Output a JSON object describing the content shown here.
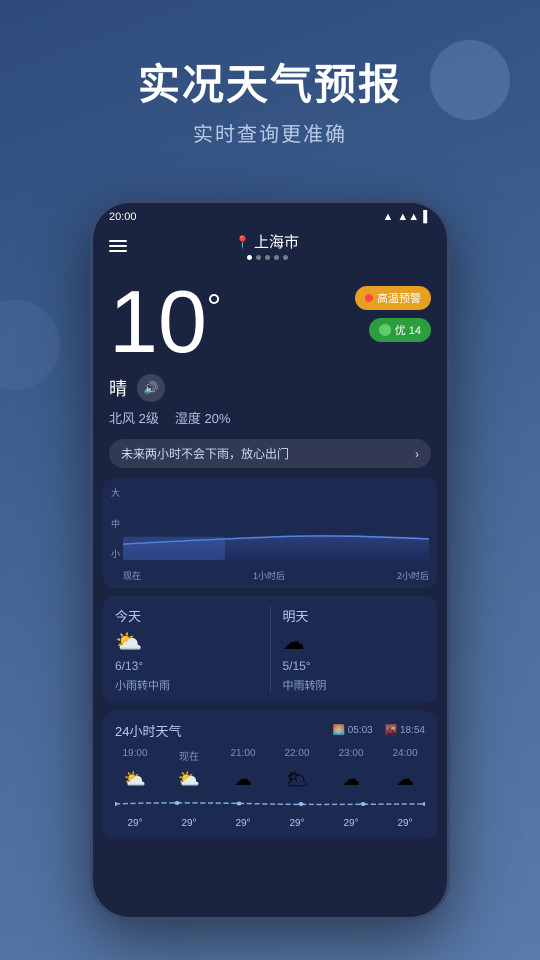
{
  "app": {
    "title": "实况天气预报",
    "subtitle": "实时查询更准确"
  },
  "status_bar": {
    "time": "20:00",
    "wifi": "▲",
    "signal": "▲▲",
    "battery": "▌"
  },
  "nav": {
    "city": "上海市",
    "dots": [
      true,
      false,
      false,
      false,
      false
    ]
  },
  "weather": {
    "temperature": "10",
    "degree_symbol": "°",
    "condition": "晴",
    "alert_label": "高温预警",
    "aqi_label": "优 14",
    "wind": "北风 2级",
    "humidity": "湿度 20%",
    "forecast_hint": "未来两小时不会下雨，放心出门"
  },
  "precip_chart": {
    "y_labels": [
      "大",
      "中",
      "小"
    ],
    "x_labels": [
      "现在",
      "1小时后",
      "2小时后"
    ]
  },
  "daily": {
    "today": {
      "label": "今天",
      "temp": "6/13°",
      "condition": "小雨转中雨"
    },
    "tomorrow": {
      "label": "明天",
      "temp": "5/15°",
      "condition": "中雨转阴"
    }
  },
  "hourly": {
    "title": "24小时天气",
    "sunrise": "05:03",
    "sunset": "18:54",
    "items": [
      {
        "time": "19:00",
        "icon": "⛅",
        "temp": "29°"
      },
      {
        "time": "现在",
        "icon": "⛅",
        "temp": "29°"
      },
      {
        "time": "21:00",
        "icon": "☁",
        "temp": "29°"
      },
      {
        "time": "22:00",
        "icon": "🌥",
        "temp": "29°"
      },
      {
        "time": "23:00",
        "icon": "☁",
        "temp": "29°"
      },
      {
        "time": "24:00",
        "icon": "☁",
        "temp": "29°"
      }
    ]
  }
}
